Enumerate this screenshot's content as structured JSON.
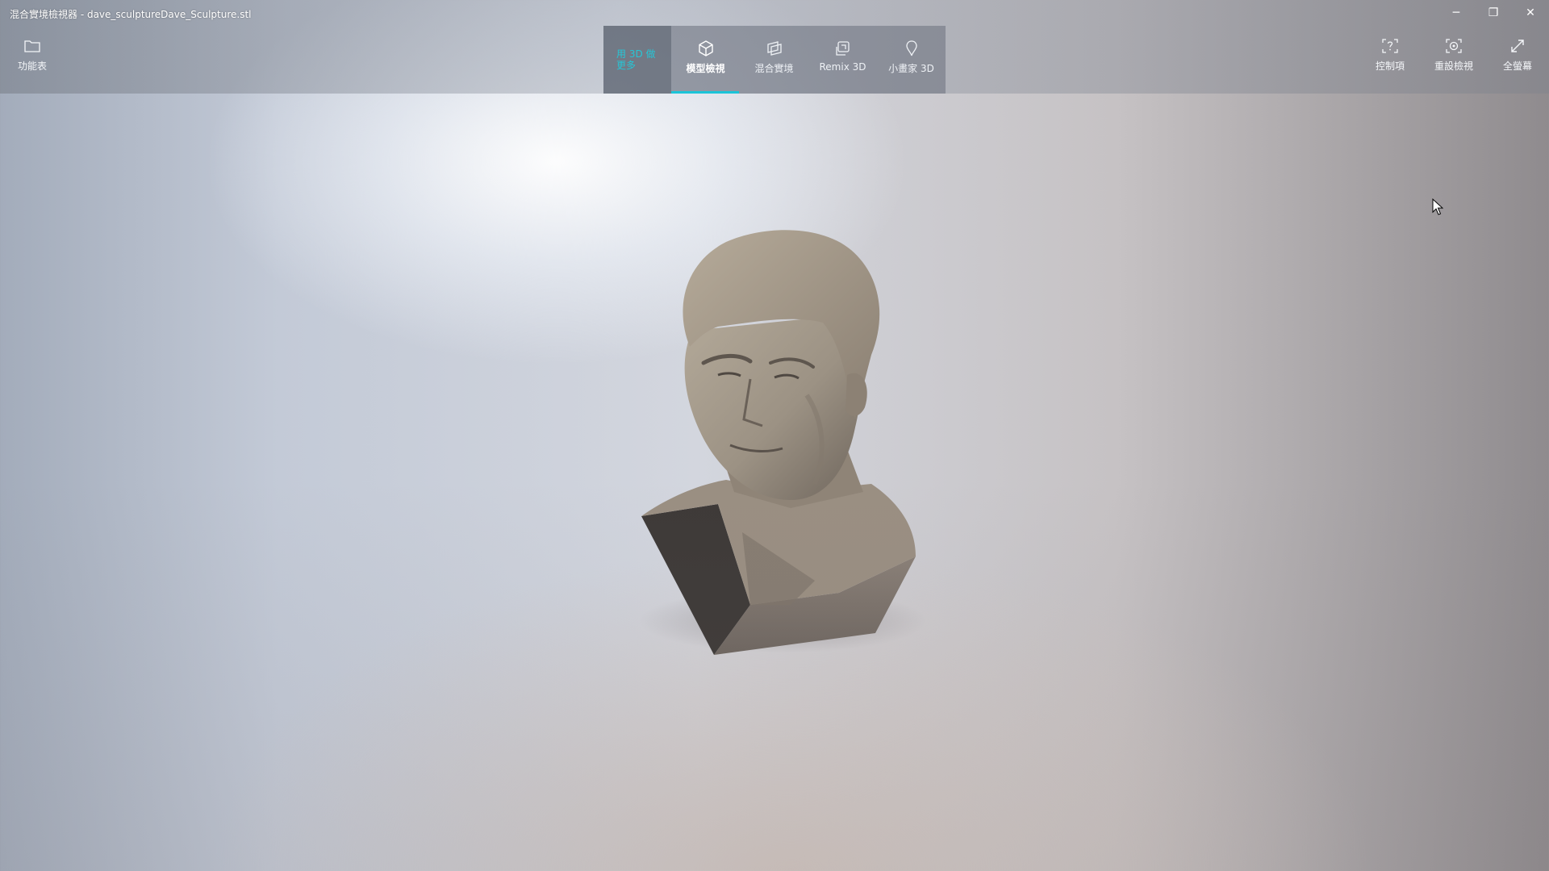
{
  "window": {
    "title": "混合實境檢視器 - dave_sculptureDave_Sculpture.stl",
    "minimize_glyph": "─",
    "restore_glyph": "❐",
    "close_glyph": "✕"
  },
  "toolbar": {
    "menu_label": "功能表",
    "more_3d_label": "用 3D 做更多",
    "tabs": [
      {
        "label": "模型檢視",
        "icon": "cube-icon",
        "active": true
      },
      {
        "label": "混合實境",
        "icon": "mixed-reality-icon",
        "active": false
      },
      {
        "label": "Remix 3D",
        "icon": "remix-icon",
        "active": false
      },
      {
        "label": "小畫家 3D",
        "icon": "paint3d-icon",
        "active": false
      }
    ],
    "controls_label": "控制項",
    "reset_view_label": "重設檢視",
    "fullscreen_label": "全螢幕"
  },
  "colors": {
    "accent": "#1cc4d8",
    "model": "#9a8f83"
  }
}
